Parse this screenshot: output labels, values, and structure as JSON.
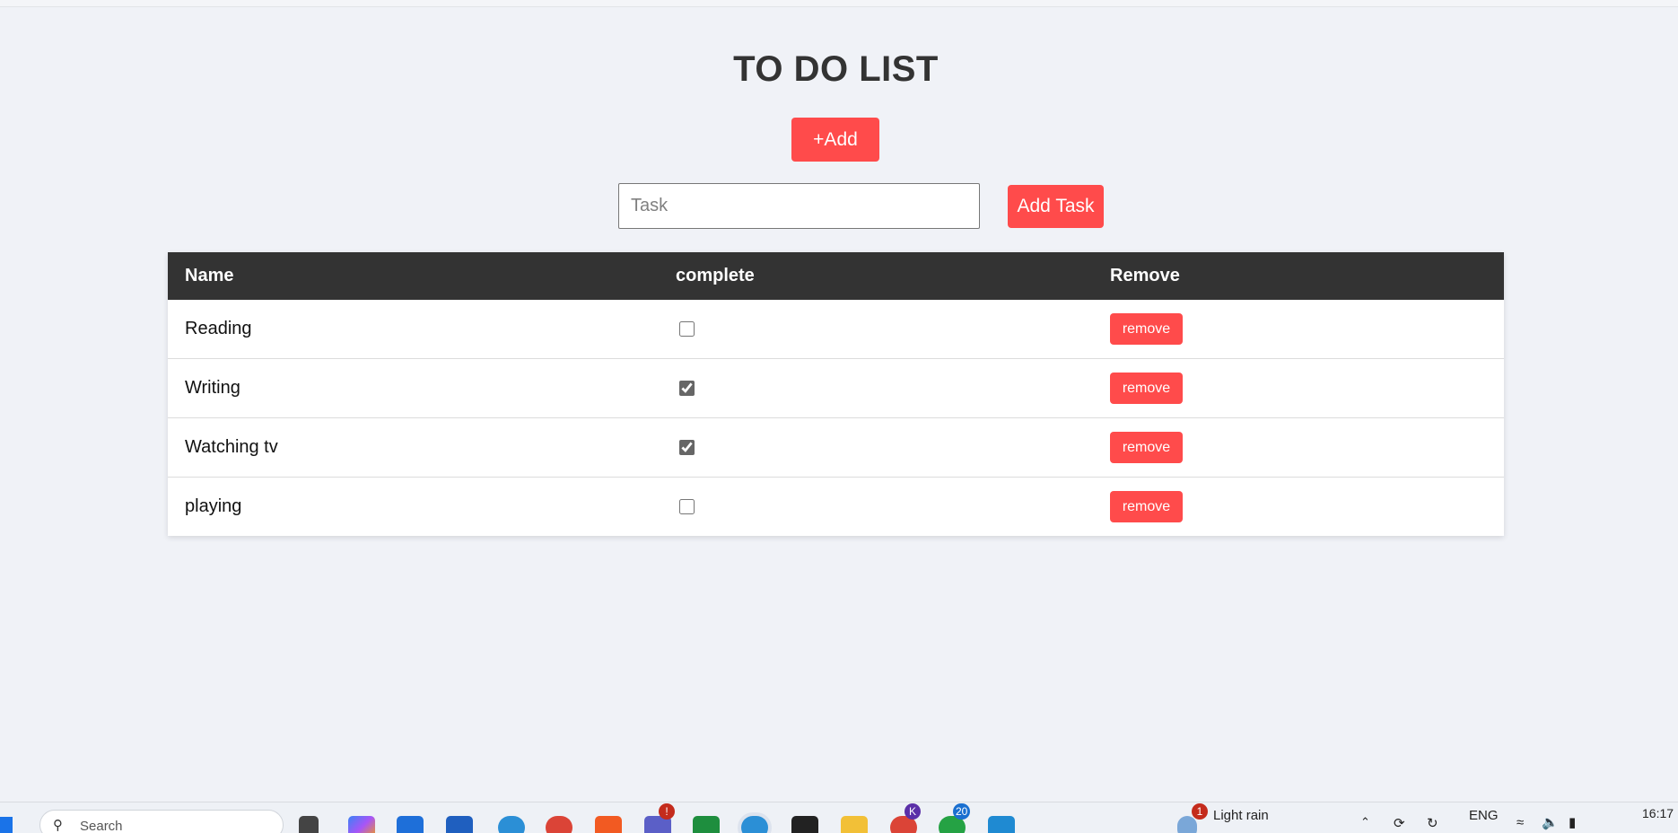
{
  "page": {
    "title": "TO DO LIST",
    "add_toggle_label": "+Add",
    "task_placeholder": "Task",
    "add_task_label": "Add Task"
  },
  "table": {
    "headers": [
      "Name",
      "complete",
      "Remove"
    ],
    "rows": [
      {
        "name": "Reading",
        "complete": false,
        "remove_label": "remove"
      },
      {
        "name": "Writing",
        "complete": true,
        "remove_label": "remove"
      },
      {
        "name": "Watching tv",
        "complete": true,
        "remove_label": "remove"
      },
      {
        "name": "playing",
        "complete": false,
        "remove_label": "remove"
      }
    ]
  },
  "taskbar": {
    "search_placeholder": "Search",
    "weather_badge": "1",
    "weather_text": "Light rain",
    "language": "ENG",
    "clock": "16:17",
    "teams_badge": "!",
    "chrome_profile_badge": "K",
    "whatsapp_badge": "20",
    "icons": [
      "windows-start-icon",
      "task-view-icon",
      "copilot-icon",
      "phone-link-icon",
      "store-icon",
      "edge-icon",
      "chrome-icon",
      "brave-icon",
      "teams-icon",
      "classroom-icon",
      "edge-icon",
      "terminal-icon",
      "file-explorer-icon",
      "chrome-profile-icon",
      "whatsapp-icon",
      "vscode-icon"
    ]
  },
  "colors": {
    "accent": "#ff4b4b",
    "header_bg": "#333333",
    "page_bg": "#f0f2f7"
  }
}
